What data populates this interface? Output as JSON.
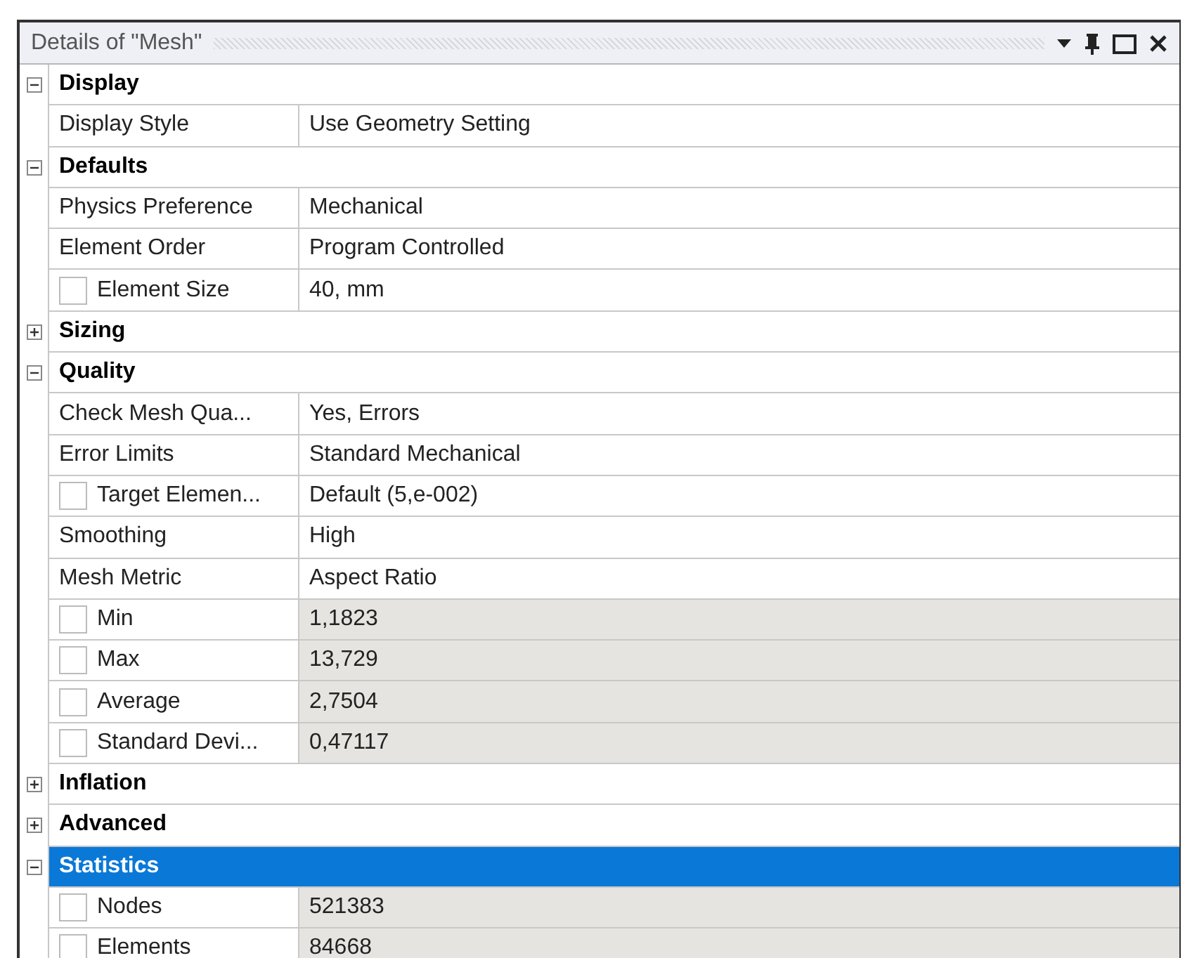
{
  "panel": {
    "title": "Details of \"Mesh\""
  },
  "groups": [
    {
      "label": "Display",
      "expanded": true,
      "selected": false,
      "properties": [
        {
          "kind": "plain",
          "label": "Display Style",
          "value": "Use Geometry Setting",
          "readonly": false
        }
      ]
    },
    {
      "label": "Defaults",
      "expanded": true,
      "selected": false,
      "properties": [
        {
          "kind": "plain",
          "label": "Physics Preference",
          "value": "Mechanical",
          "readonly": false
        },
        {
          "kind": "plain",
          "label": "Element Order",
          "value": "Program Controlled",
          "readonly": false
        },
        {
          "kind": "checkbox",
          "checked": false,
          "label": "Element Size",
          "value": "40, mm",
          "readonly": false
        }
      ]
    },
    {
      "label": "Sizing",
      "expanded": false,
      "selected": false
    },
    {
      "label": "Quality",
      "expanded": true,
      "selected": false,
      "properties": [
        {
          "kind": "plain",
          "label": "Check Mesh Qua...",
          "value": "Yes, Errors",
          "readonly": false
        },
        {
          "kind": "plain",
          "label": "Error Limits",
          "value": "Standard Mechanical",
          "readonly": false
        },
        {
          "kind": "checkbox",
          "checked": false,
          "label": "Target Elemen...",
          "value": "Default (5,e-002)",
          "readonly": false
        },
        {
          "kind": "plain",
          "label": "Smoothing",
          "value": "High",
          "readonly": false
        },
        {
          "kind": "plain",
          "label": "Mesh Metric",
          "value": "Aspect Ratio",
          "readonly": false
        },
        {
          "kind": "checkbox",
          "checked": false,
          "label": "Min",
          "value": "1,1823",
          "readonly": true
        },
        {
          "kind": "checkbox",
          "checked": false,
          "label": "Max",
          "value": "13,729",
          "readonly": true
        },
        {
          "kind": "checkbox",
          "checked": false,
          "label": "Average",
          "value": "2,7504",
          "readonly": true
        },
        {
          "kind": "checkbox",
          "checked": false,
          "label": "Standard Devi...",
          "value": "0,47117",
          "readonly": true
        }
      ]
    },
    {
      "label": "Inflation",
      "expanded": false,
      "selected": false
    },
    {
      "label": "Advanced",
      "expanded": false,
      "selected": false
    },
    {
      "label": "Statistics",
      "expanded": true,
      "selected": true,
      "properties": [
        {
          "kind": "checkbox",
          "checked": false,
          "label": "Nodes",
          "value": "521383",
          "readonly": true
        },
        {
          "kind": "checkbox",
          "checked": false,
          "label": "Elements",
          "value": "84668",
          "readonly": true
        }
      ]
    }
  ]
}
